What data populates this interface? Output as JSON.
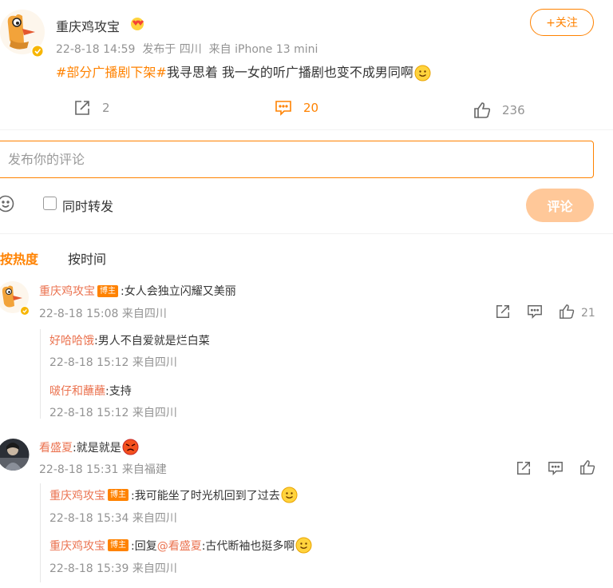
{
  "post": {
    "author": "重庆鸡攻宝",
    "meta": "22-8-18 14:59  发布于 四川  来自 iPhone 13 mini",
    "follow_label": "+关注",
    "topic": "#部分广播剧下架#",
    "body": "我寻思着 我一女的听广播剧也变不成男同啊",
    "repost_count": "2",
    "comment_count": "20",
    "like_count": "236"
  },
  "composer": {
    "placeholder": "发布你的评论",
    "also_forward_label": "同时转发",
    "submit_label": "评论"
  },
  "sort": {
    "hot_label": "按热度",
    "time_label": "按时间"
  },
  "comments": [
    {
      "name": "重庆鸡攻宝",
      "badge": "博主",
      "text": ":女人会独立闪耀又美丽",
      "time": "22-8-18 15:08 来自四川",
      "likes": "21",
      "replies": [
        {
          "name": "好哈哈饿",
          "text": ":男人不自爱就是烂白菜",
          "time": "22-8-18 15:12 来自四川"
        },
        {
          "name": "啵仔和蘸蘸",
          "text": ":支持",
          "time": "22-8-18 15:12 来自四川"
        }
      ]
    },
    {
      "name": "看盛夏",
      "text": ":就是就是",
      "time": "22-8-18 15:31 来自福建",
      "replies": [
        {
          "name": "重庆鸡攻宝",
          "badge": "博主",
          "text": ":我可能坐了时光机回到了过去",
          "time": "22-8-18 15:34 来自四川"
        },
        {
          "name": "重庆鸡攻宝",
          "badge": "博主",
          "prefix": ":回复",
          "mention": "@看盛夏",
          "text": ":古代断袖也挺多啊",
          "time": "22-8-18 15:39 来自四川"
        }
      ]
    }
  ],
  "colors": {
    "accent": "#ff8200",
    "link": "#eb7350",
    "submit_disabled": "#ffc899"
  }
}
